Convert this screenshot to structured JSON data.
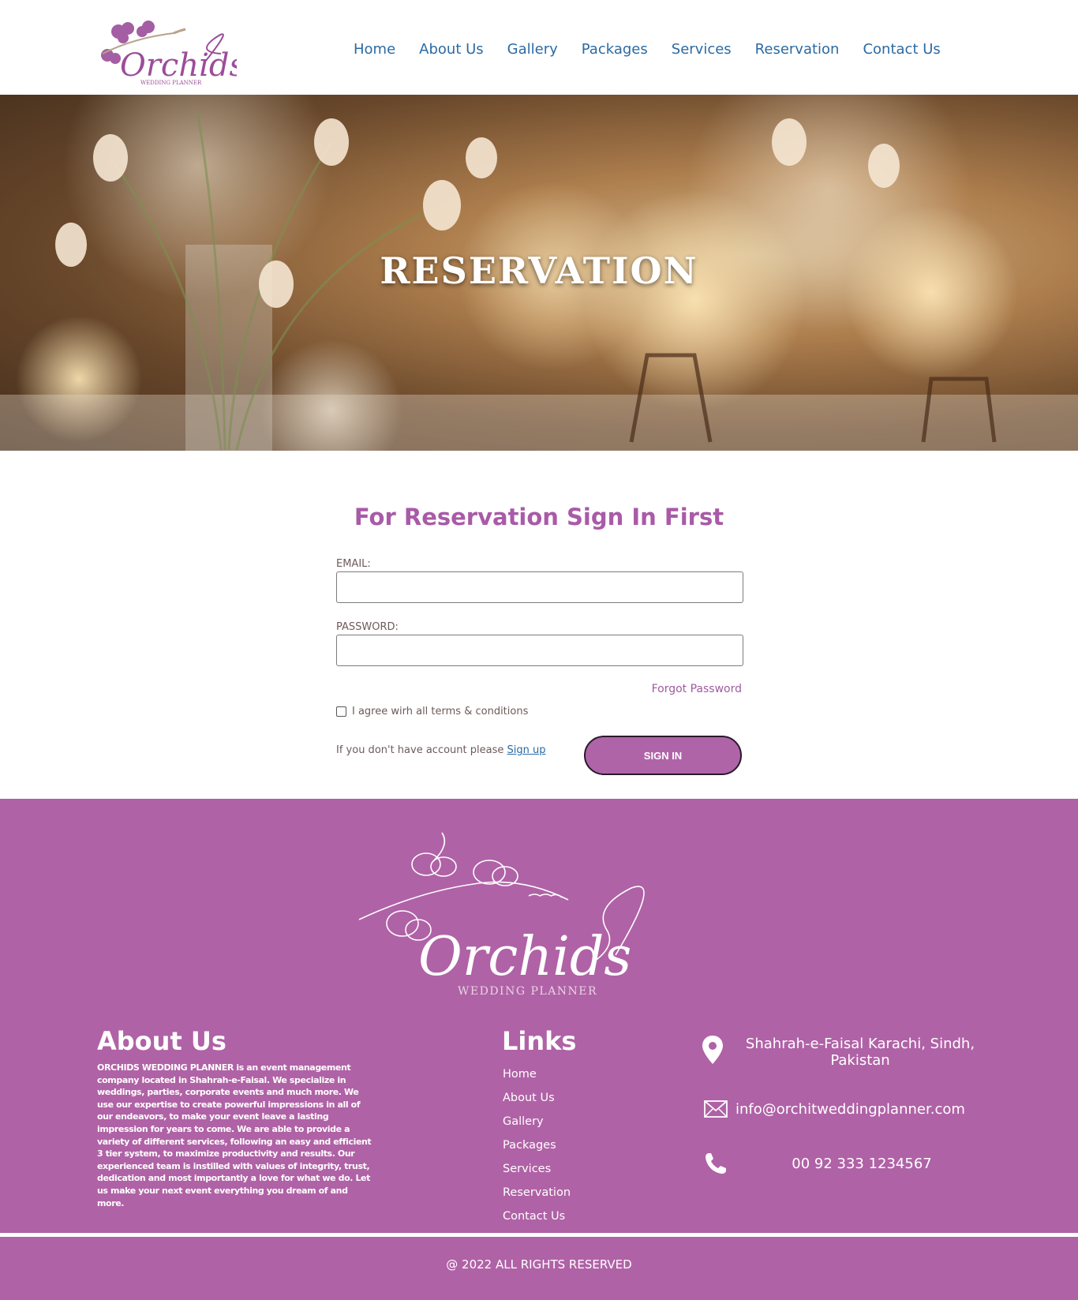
{
  "brand": {
    "logo_script": "Orchids",
    "logo_sub": "WEDDING PLANNER"
  },
  "nav": {
    "items": [
      {
        "label": "Home"
      },
      {
        "label": "About Us"
      },
      {
        "label": "Gallery"
      },
      {
        "label": "Packages"
      },
      {
        "label": "Services"
      },
      {
        "label": "Reservation"
      },
      {
        "label": "Contact Us"
      }
    ]
  },
  "hero": {
    "title": "RESERVATION"
  },
  "form": {
    "title": "For Reservation Sign In First",
    "email_label": "EMAIL:",
    "email_value": "",
    "password_label": "PASSWORD:",
    "password_value": "",
    "forgot_label": "Forgot Password",
    "agree_label": "I agree wirh all terms & conditions",
    "signup_prompt": "If you don't have account please ",
    "signup_link": "Sign up",
    "signin_label": "SIGN IN"
  },
  "footer": {
    "about_title": "About Us",
    "about_text": "ORCHIDS WEDDING PLANNER is an event management company located in Shahrah-e-Faisal. We specialize in weddings, parties, corporate events and much more. We use our expertise to create powerful impressions in all of our endeavors, to make your event leave a lasting impression for years to come. We are able to provide a variety of different services, following an easy and efficient 3 tier system, to maximize productivity and results. Our experienced team is instilled with values of integrity, trust, dedication and most importantly a love for what we do. Let us make your next event everything you dream of and more.",
    "links_title": "Links",
    "links": [
      "Home",
      "About Us",
      "Gallery",
      "Packages",
      "Services",
      "Reservation",
      "Contact Us"
    ],
    "address_line1": "Shahrah-e-Faisal Karachi, Sindh,",
    "address_line2": "Pakistan",
    "email": "info@orchitweddingplanner.com",
    "phone": "00 92 333 1234567",
    "copyright": "@ 2022 ALL RIGHTS RESERVED"
  },
  "colors": {
    "accent": "#b062a6",
    "nav": "#2b6aa3",
    "title": "#a95aa8"
  }
}
